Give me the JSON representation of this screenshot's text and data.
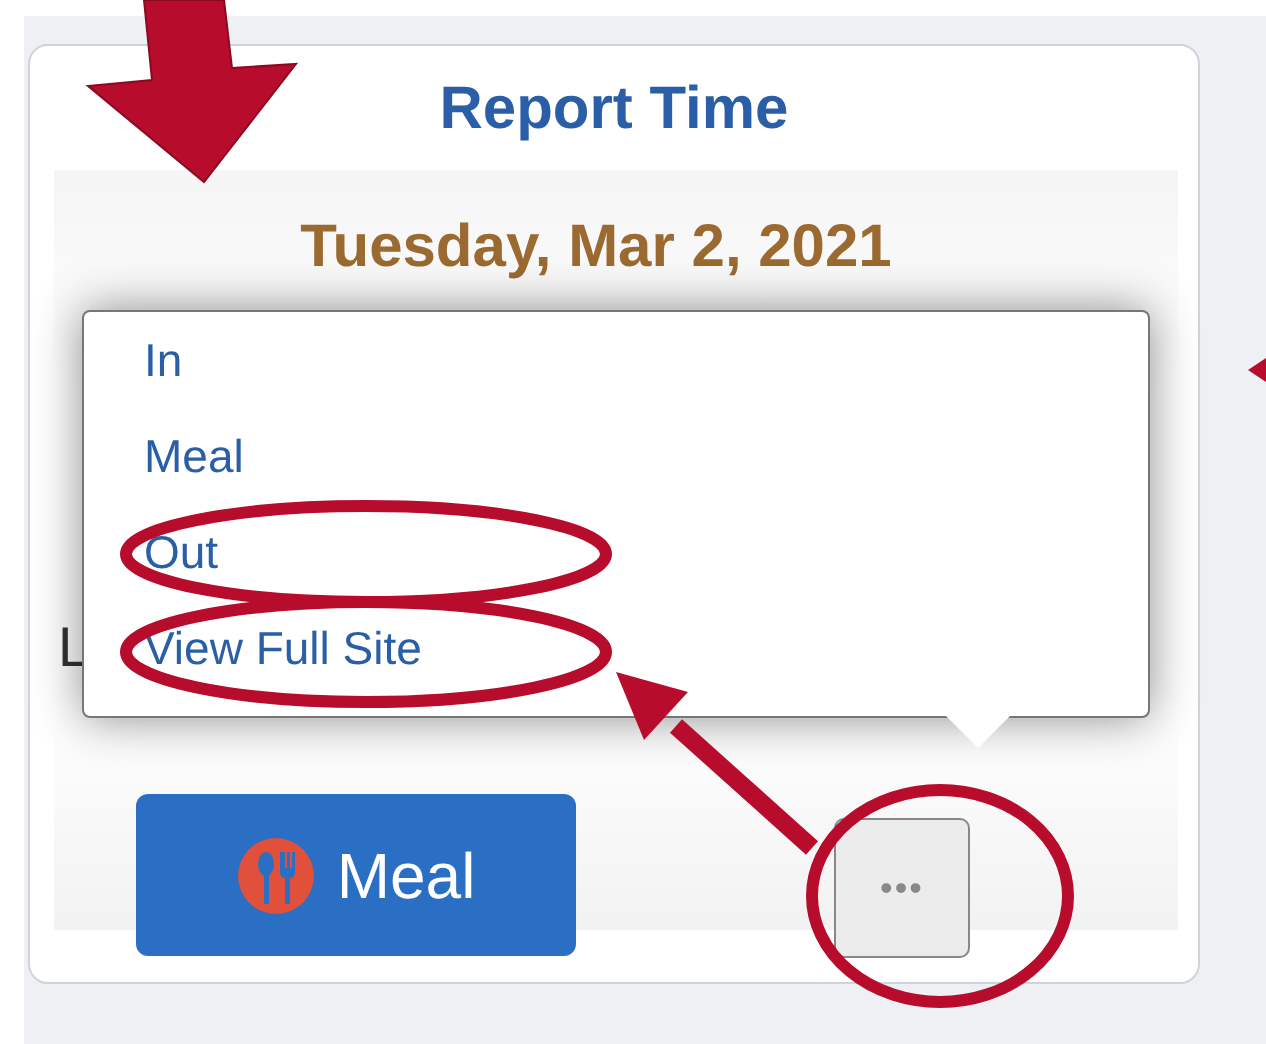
{
  "card": {
    "title": "Report Time",
    "date": "Tuesday, Mar 2, 2021",
    "partial_label": "L",
    "menu": {
      "items": [
        {
          "label": "In"
        },
        {
          "label": "Meal"
        },
        {
          "label": "Out"
        },
        {
          "label": "View Full Site"
        }
      ]
    },
    "buttons": [
      {
        "kind": "primary",
        "label": "Meal"
      },
      {
        "kind": "more",
        "label": "•••"
      }
    ]
  }
}
